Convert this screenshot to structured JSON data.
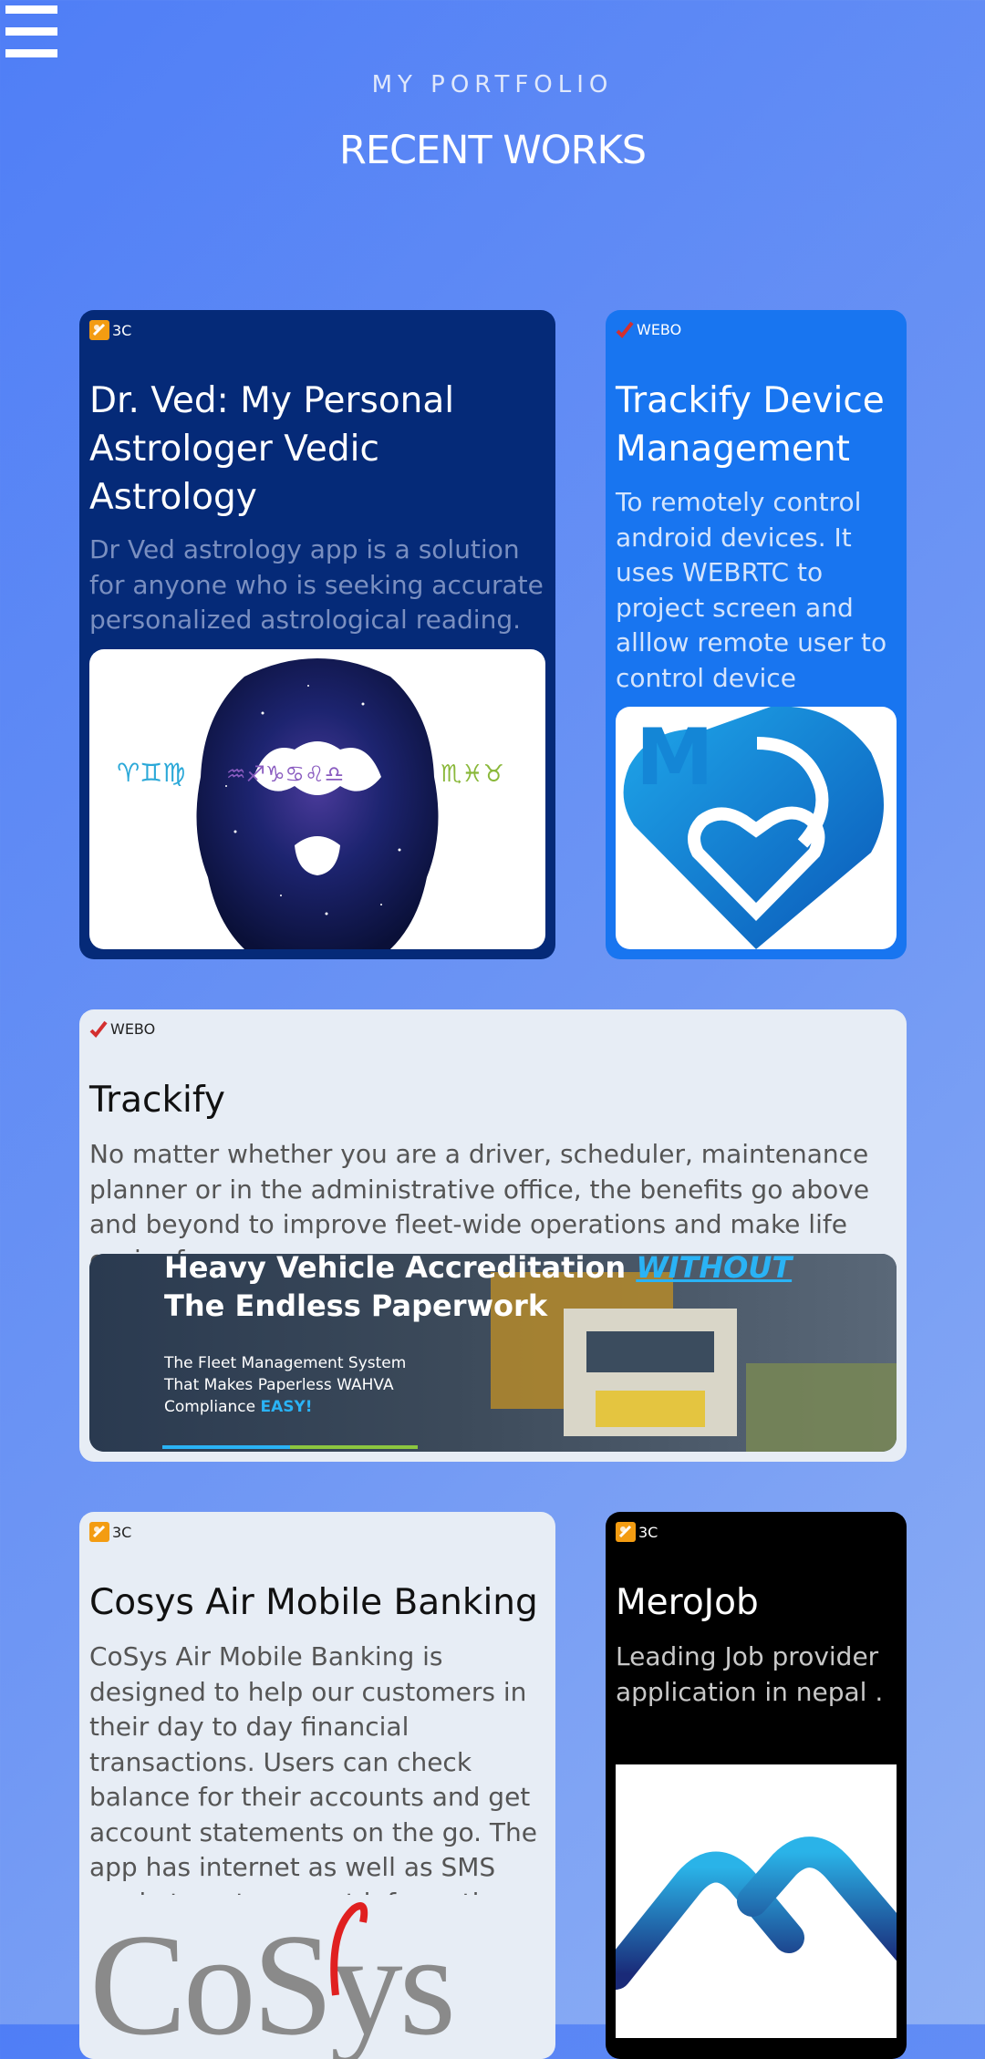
{
  "header": {
    "subtitle": "MY PORTFOLIO",
    "title": "RECENT WORKS"
  },
  "menu_icon": "hamburger-icon",
  "projects": [
    {
      "badge": "3C",
      "badge_icon": "3c-logo-icon",
      "title": "Dr. Ved: My Personal Astrologer Vedic Astrology",
      "description": "Dr Ved astrology app is a solution for anyone who is seeking accurate personalized astrological reading.",
      "image": {
        "zodiac_left": "♈♊♍",
        "zodiac_mid": "♒♐♑♋♌♎",
        "zodiac_right": "♏♓♉"
      }
    },
    {
      "badge": "WEBO",
      "badge_icon": "webo-logo-icon",
      "title": "Trackify Device Management",
      "description": "To remotely control android devices. It uses WEBRTC to project screen and alllow remote user to control device",
      "image": {
        "letter": "M"
      }
    },
    {
      "badge": "WEBO",
      "badge_icon": "webo-logo-icon",
      "title": "Trackify",
      "description": "No matter whether you are a driver, scheduler, maintenance planner or in the administrative office, the benefits go above and beyond to improve fleet-wide operations and make life easier for you",
      "image": {
        "headline_1": "Heavy Vehicle Accreditation",
        "headline_highlight": "WITHOUT",
        "headline_2": "The Endless Paperwork",
        "body_1": "The Fleet Management System",
        "body_2": "That Makes Paperless WAHVA",
        "body_3": "Compliance",
        "body_highlight": "EASY!"
      }
    },
    {
      "badge": "3C",
      "badge_icon": "3c-logo-icon",
      "title": "Cosys Air Mobile Banking",
      "description": "CoSys Air Mobile Banking is designed to help our customers in their day to day financial transactions. Users can check balance for their accounts and get account statements on the go. The app has internet as well as SMS mode to get account information.",
      "image": {
        "logo_text": "CoSys"
      }
    },
    {
      "badge": "3C",
      "badge_icon": "3c-logo-icon",
      "title": "MeroJob",
      "description": "Leading Job provider application in nepal .",
      "image": {}
    }
  ],
  "colors": {
    "card_dark_navy": "#052a78",
    "card_blue": "#1875f0",
    "card_light": "#e7edf5",
    "card_black": "#000000",
    "accent_cyan": "#2ab3f5"
  }
}
